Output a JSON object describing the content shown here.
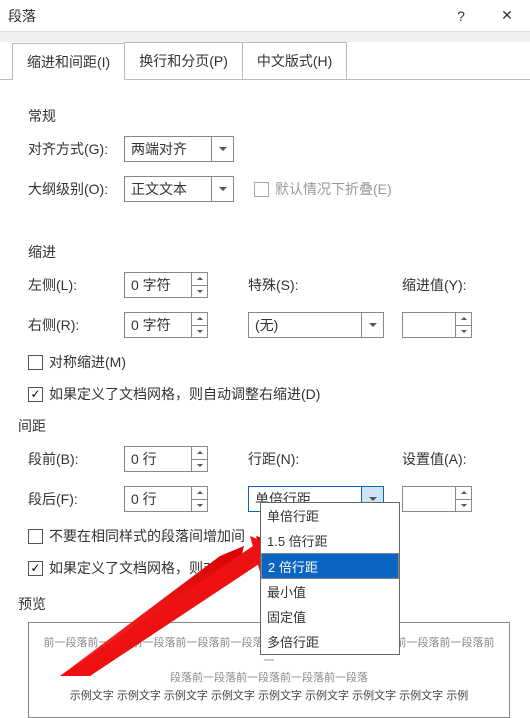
{
  "titlebar": {
    "title": "段落"
  },
  "tabs": {
    "t1": "缩进和间距(I)",
    "t2": "换行和分页(P)",
    "t3": "中文版式(H)"
  },
  "general": {
    "section": "常规",
    "align_label": "对齐方式(G):",
    "align_value": "两端对齐",
    "outline_label": "大纲级别(O):",
    "outline_value": "正文文本",
    "collapse_label": "默认情况下折叠(E)"
  },
  "indent": {
    "section": "缩进",
    "left_label": "左侧(L):",
    "left_value": "0 字符",
    "right_label": "右侧(R):",
    "right_value": "0 字符",
    "special_label": "特殊(S):",
    "special_value": "(无)",
    "by_label": "缩进值(Y):",
    "by_value": "",
    "mirror_label": "对称缩进(M)",
    "grid_label": "如果定义了文档网格，则自动调整右缩进(D)"
  },
  "spacing": {
    "section": "间距",
    "before_label": "段前(B):",
    "before_value": "0 行",
    "after_label": "段后(F):",
    "after_value": "0 行",
    "line_label": "行距(N):",
    "line_value": "单倍行距",
    "at_label": "设置值(A):",
    "at_value": "",
    "nospace_label": "不要在相同样式的段落间增加间",
    "snap_label": "如果定义了文档网格，则对齐到"
  },
  "dropdown": {
    "o1": "单倍行距",
    "o2": "1.5 倍行距",
    "o3": "2 倍行距",
    "o4": "最小值",
    "o5": "固定值",
    "o6": "多倍行距"
  },
  "preview": {
    "label": "预览",
    "line1": "前一段落前一段落前一段落前一段落前一段落前一段落前一段落前一段落前一段落前一段落前一",
    "line2": "段落前一段落前一段落前一段落前一段落",
    "line3": "示例文字 示例文字 示例文字 示例文字 示例文字 示例文字 示例文字 示例文字 示例"
  }
}
